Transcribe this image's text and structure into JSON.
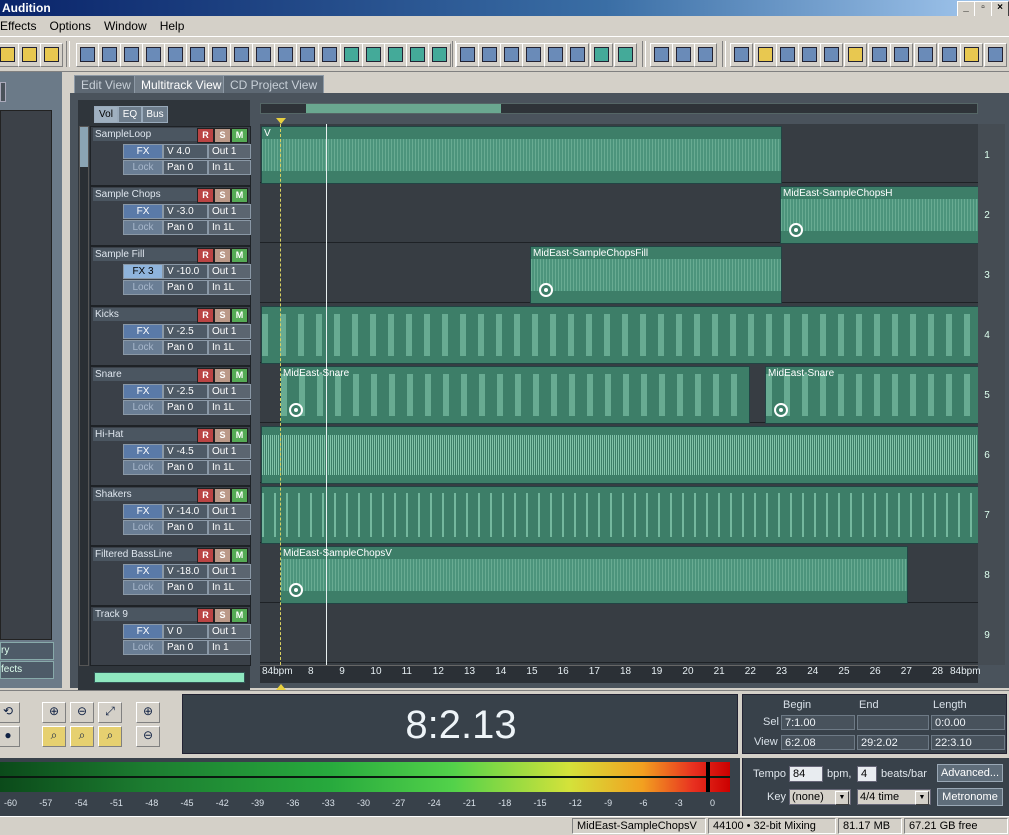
{
  "window": {
    "title": "Audition"
  },
  "menu": [
    "Effects",
    "Options",
    "Window",
    "Help"
  ],
  "view_tabs": [
    "Edit View",
    "Multitrack View",
    "CD Project View"
  ],
  "track_view_buttons": [
    "Vol",
    "EQ",
    "Bus"
  ],
  "left_panel": {
    "items": [
      "ry",
      "fects"
    ]
  },
  "tracks": [
    {
      "name": "SampleLoop",
      "fx": "FX",
      "vol": "V 4.0",
      "out": "Out 1",
      "lock": "Lock",
      "pan": "Pan 0",
      "in": "In 1L",
      "lane": "1"
    },
    {
      "name": "Sample Chops",
      "fx": "FX",
      "vol": "V -3.0",
      "out": "Out 1",
      "lock": "Lock",
      "pan": "Pan 0",
      "in": "In 1L",
      "lane": "2"
    },
    {
      "name": "Sample Fill",
      "fx": "FX 3",
      "vol": "V -10.0",
      "out": "Out 1",
      "lock": "Lock",
      "pan": "Pan 0",
      "in": "In 1L",
      "lane": "3"
    },
    {
      "name": "Kicks",
      "fx": "FX",
      "vol": "V -2.5",
      "out": "Out 1",
      "lock": "Lock",
      "pan": "Pan 0",
      "in": "In 1L",
      "lane": "4"
    },
    {
      "name": "Snare",
      "fx": "FX",
      "vol": "V -2.5",
      "out": "Out 1",
      "lock": "Lock",
      "pan": "Pan 0",
      "in": "In 1L",
      "lane": "5"
    },
    {
      "name": "Hi-Hat",
      "fx": "FX",
      "vol": "V -4.5",
      "out": "Out 1",
      "lock": "Lock",
      "pan": "Pan 0",
      "in": "In 1L",
      "lane": "6"
    },
    {
      "name": "Shakers",
      "fx": "FX",
      "vol": "V -14.0",
      "out": "Out 1",
      "lock": "Lock",
      "pan": "Pan 0",
      "in": "In 1L",
      "lane": "7"
    },
    {
      "name": "Filtered BassLine",
      "fx": "FX",
      "vol": "V -18.0",
      "out": "Out 1",
      "lock": "Lock",
      "pan": "Pan 0",
      "in": "In 1L",
      "lane": "8"
    },
    {
      "name": "Track 9",
      "fx": "FX",
      "vol": "V 0",
      "out": "Out 1",
      "lock": "Lock",
      "pan": "Pan 0",
      "in": "In 1",
      "lane": "9"
    }
  ],
  "rsm": {
    "r": "R",
    "s": "S",
    "m": "M"
  },
  "clips": {
    "c1": "V",
    "c2": "MidEast-SampleChopsH",
    "c3": "MidEast-SampleChopsFill",
    "c5a": "MidEast-Snare",
    "c5b": "MidEast-Snare",
    "c8": "MidEast-SampleChopsV"
  },
  "ruler": {
    "ticks": [
      "84bpm",
      "8",
      "9",
      "10",
      "11",
      "12",
      "13",
      "14",
      "15",
      "16",
      "17",
      "18",
      "19",
      "20",
      "21",
      "22",
      "23",
      "24",
      "25",
      "26",
      "27",
      "28",
      "84bpm"
    ]
  },
  "time_display": "8:2.13",
  "sel_view": {
    "headers": [
      "Begin",
      "End",
      "Length"
    ],
    "sel_label": "Sel",
    "view_label": "View",
    "sel": [
      "7:1.00",
      "",
      "0:0.00"
    ],
    "view": [
      "6:2.08",
      "29:2.02",
      "22:3.10"
    ]
  },
  "meter": {
    "ticks": [
      "-60",
      "-57",
      "-54",
      "-51",
      "-48",
      "-45",
      "-42",
      "-39",
      "-36",
      "-33",
      "-30",
      "-27",
      "-24",
      "-21",
      "-18",
      "-15",
      "-12",
      "-9",
      "-6",
      "-3",
      "0"
    ]
  },
  "tempo": {
    "tempo_label": "Tempo",
    "tempo_value": "84",
    "bpm_label": "bpm,",
    "beats_value": "4",
    "beats_label": "beats/bar",
    "advanced": "Advanced...",
    "key_label": "Key",
    "key_value": "(none)",
    "time_sig": "4/4 time",
    "metronome": "Metronome"
  },
  "status": {
    "file": "MidEast-SampleChopsV",
    "format": "44100 • 32-bit Mixing",
    "memory": "81.17 MB",
    "free": "67.21 GB free"
  }
}
